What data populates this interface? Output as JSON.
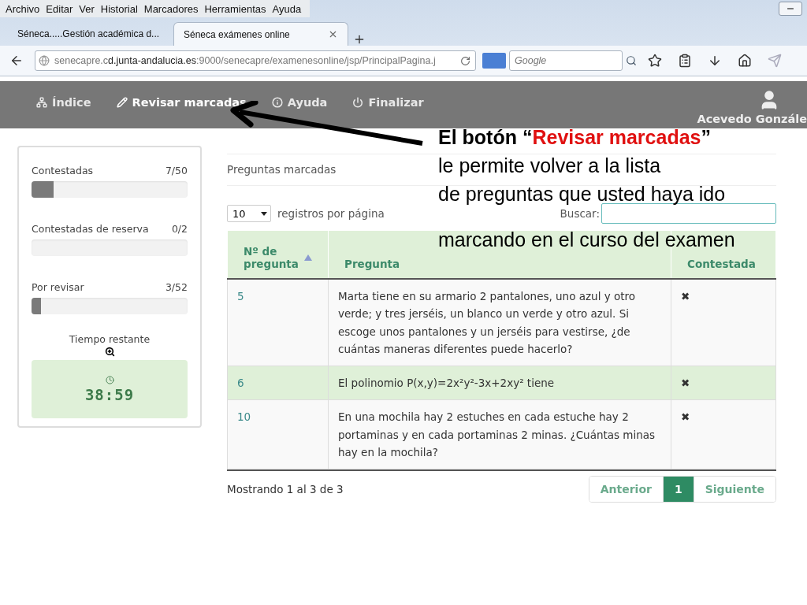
{
  "menu_bar": [
    "Archivo",
    "Editar",
    "Ver",
    "Historial",
    "Marcadores",
    "Herramientas",
    "Ayuda"
  ],
  "tabs": [
    {
      "label": "Séneca.....Gestión académica d...",
      "selected": false
    },
    {
      "label": "Séneca exámenes online",
      "selected": true
    }
  ],
  "address_bar": {
    "host_prefix": "senecapre.c",
    "host": "d.junta-andalucia.es",
    "path": ":9000/senecapre/examenesonline/jsp/PrincipalPagina.j"
  },
  "search_box": {
    "placeholder": "Google"
  },
  "app_nav": [
    {
      "kind": "index",
      "label": "Índice",
      "selected": false
    },
    {
      "kind": "review",
      "label": "Revisar marcadas",
      "selected": true
    },
    {
      "kind": "help",
      "label": "Ayuda",
      "selected": false
    },
    {
      "kind": "finish",
      "label": "Finalizar",
      "selected": false
    }
  ],
  "user": {
    "name": "Acevedo Gonzále"
  },
  "progress": [
    {
      "label": "Contestadas",
      "reading": "7/50",
      "level": 0.14
    },
    {
      "label": "Contestadas de reserva",
      "reading": "0/2",
      "level": 0
    },
    {
      "label": "Por revisar",
      "reading": "3/52",
      "level": 0.06
    }
  ],
  "timer": {
    "label": "Tiempo restante",
    "value": "38:59"
  },
  "marked": {
    "title": "Preguntas marcadas",
    "page_size": "10",
    "page_size_label": "registros por página",
    "search_label": "Buscar:",
    "columns": [
      "Nº de pregunta",
      "Pregunta",
      "Contestada"
    ],
    "rows": [
      {
        "number": "5",
        "question": "Marta tiene en su armario 2 pantalones, uno azul y otro verde; y tres jerséis, un blanco un verde y otro azul. Si escoge unos pantalones y un jerséis para vestirse, ¿de cuántas maneras diferentes puede hacerlo?",
        "answered": "✖",
        "selected": false
      },
      {
        "number": "6",
        "question": "El polinomio P(x,y)=2x²y²-3x+2xy² tiene",
        "answered": "✖",
        "selected": true
      },
      {
        "number": "10",
        "question": "En una mochila hay 2 estuches en cada estuche hay 2 portaminas y en cada portaminas 2 minas. ¿Cuántas minas hay en la mochila?",
        "answered": "✖",
        "selected": false
      }
    ],
    "summary": "Mostrando 1 al 3 de 3",
    "pagination": [
      {
        "label": "Anterior",
        "selected": false
      },
      {
        "label": "1",
        "selected": true
      },
      {
        "label": "Siguiente",
        "selected": false
      }
    ]
  },
  "callout": {
    "title": [
      {
        "text": "El botón “",
        "highlight": false
      },
      {
        "text": "Revisar marcadas",
        "highlight": true
      },
      {
        "text": "”",
        "highlight": false
      }
    ],
    "lines": [
      "le permite volver a la lista",
      "de preguntas que usted haya ido",
      "marcando en el curso del examen"
    ]
  }
}
